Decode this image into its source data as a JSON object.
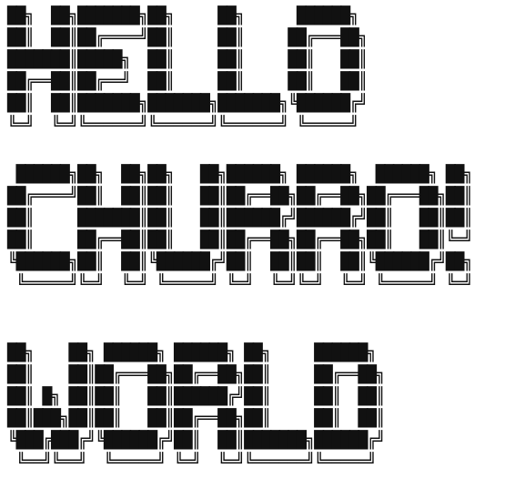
{
  "blocks": [
    {
      "lines": [
        "██╗  ██╗███████╗██╗     ██╗      ██████╗ ",
        "██║  ██║██╔════╝██║     ██║     ██╔═══██╗",
        "███████║█████╗  ██║     ██║     ██║   ██║",
        "██╔══██║██╔══╝  ██║     ██║     ██║   ██║",
        "██║  ██║███████╗███████╗███████╗╚██████╔╝",
        "╚═╝  ╚═╝╚══════╝╚══════╝╚══════╝ ╚═════╝ "
      ]
    },
    {
      "lines": [
        " ██████╗██╗  ██╗██╗   ██╗██████╗ ██████╗  ██████╗ ██╗",
        "██╔════╝██║  ██║██║   ██║██╔══██╗██╔══██╗██╔═══██╗██║",
        "██║     ███████║██║   ██║██████╔╝██████╔╝██║   ██║██║",
        "██║     ██╔══██║██║   ██║██╔══██╗██╔══██╗██║   ██║╚═╝",
        "╚██████╗██║  ██║╚██████╔╝██║  ██║██║  ██║╚██████╔╝██╗",
        " ╚═════╝╚═╝  ╚═╝ ╚═════╝ ╚═╝  ╚═╝╚═╝  ╚═╝ ╚═════╝ ╚═╝"
      ]
    },
    {
      "lines": [
        "██╗    ██╗ ██████╗ ██████╗ ██╗     ██████╗ ",
        "██║    ██║██╔═══██╗██╔══██╗██║     ██╔══██╗",
        "██║ █╗ ██║██║   ██║██████╔╝██║     ██║  ██║",
        "██║███╗██║██║   ██║██╔══██╗██║     ██║  ██║",
        "╚███╔███╔╝╚██████╔╝██║  ██║███████╗██████╔╝",
        " ╚══╝╚══╝  ╚═════╝ ╚═╝  ╚═╝╚══════╝╚═════╝ "
      ]
    }
  ]
}
